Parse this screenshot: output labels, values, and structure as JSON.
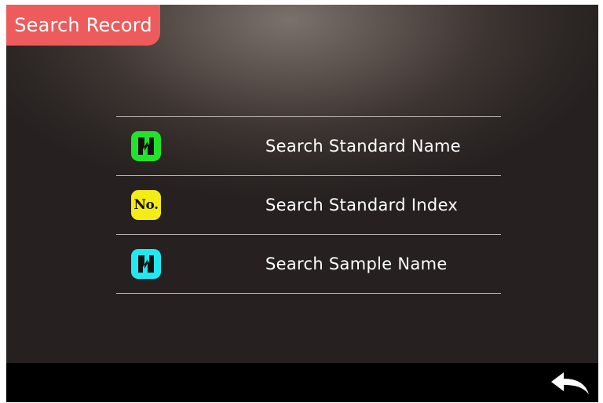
{
  "header": {
    "title": "Search Record"
  },
  "menu": {
    "items": [
      {
        "label": "Search Standard Name",
        "icon": "name-icon",
        "icon_color": "#22e22b"
      },
      {
        "label": "Search Standard Index",
        "icon": "number-icon",
        "icon_text": "No.",
        "icon_color": "#f4ec17"
      },
      {
        "label": "Search Sample Name",
        "icon": "name-icon",
        "icon_color": "#21e8f0"
      }
    ]
  },
  "footer": {
    "back_icon": "back-arrow-icon"
  },
  "colors": {
    "title_tab": "#ee5b5c",
    "bottom_bar": "#000000",
    "divider": "#b9b3ae"
  }
}
